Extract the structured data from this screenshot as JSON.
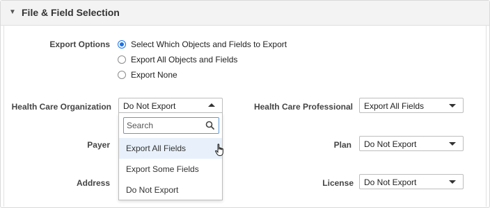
{
  "section": {
    "title": "File & Field Selection",
    "caret_glyph": "▼"
  },
  "export_options": {
    "label": "Export Options",
    "options": [
      {
        "label": "Select Which Objects and Fields to Export",
        "selected": true
      },
      {
        "label": "Export All Objects and Fields",
        "selected": false
      },
      {
        "label": "Export None",
        "selected": false
      }
    ]
  },
  "fields": {
    "health_care_organization": {
      "label": "Health Care Organization",
      "value": "Do Not Export"
    },
    "health_care_professional": {
      "label": "Health Care Professional",
      "value": "Export All Fields"
    },
    "payer": {
      "label": "Payer"
    },
    "plan": {
      "label": "Plan",
      "value": "Do Not Export"
    },
    "address": {
      "label": "Address"
    },
    "license": {
      "label": "License",
      "value": "Do Not Export"
    }
  },
  "dropdown": {
    "search_placeholder": "Search",
    "options": [
      "Export All Fields",
      "Export Some Fields",
      "Do Not Export"
    ],
    "hovered_option": "Export All Fields"
  },
  "colors": {
    "accent": "#1a73e8",
    "hover_bg": "#e8f1fb",
    "header_bg": "#f3f3f3"
  }
}
